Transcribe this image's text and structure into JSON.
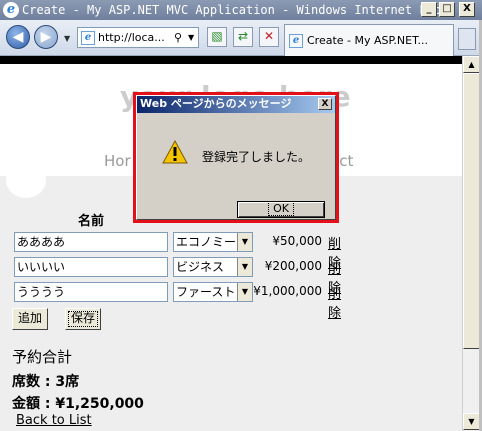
{
  "window": {
    "title": "Create - My ASP.NET MVC Application - Windows Internet Explorer",
    "min": "_",
    "max": "□",
    "close": "X"
  },
  "toolbar": {
    "address": "http://loca...",
    "tab_label": "Create - My ASP.NET..."
  },
  "page": {
    "logo": "your logo here",
    "nav_home": "Hor",
    "nav_contact": "act",
    "name_header": "名前",
    "rows": [
      {
        "name": "ああああ",
        "seat": "エコノミー",
        "price": "¥50,000",
        "delete": "削除"
      },
      {
        "name": "いいいい",
        "seat": "ビジネス",
        "price": "¥200,000",
        "delete": "削除"
      },
      {
        "name": "うううう",
        "seat": "ファースト",
        "price": "¥1,000,000",
        "delete": "削除"
      }
    ],
    "add_button": "追加",
    "save_button": "保存",
    "summary_title": "予約合計",
    "seat_count": "席数 : 3席",
    "amount": "金額 : ¥1,250,000",
    "back_link": "Back to List"
  },
  "dialog": {
    "title": "Web ページからのメッセージ",
    "message": "登録完了しました。",
    "ok": "OK",
    "close": "X"
  },
  "colors": {
    "highlight_frame": "#e3101a",
    "dialog_title": "#0a246a"
  }
}
